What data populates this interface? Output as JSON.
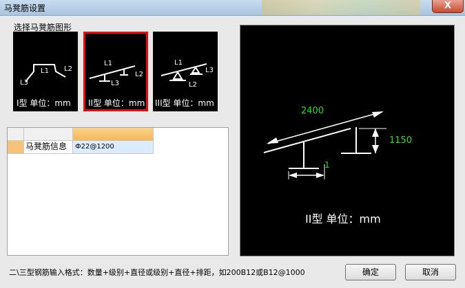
{
  "window": {
    "title": "马凳筋设置",
    "close_label": "X"
  },
  "shape_group": {
    "label": "选择马凳筋图形",
    "options": [
      {
        "caption": "I型 单位：mm",
        "labels": [
          "L1",
          "L2",
          "L3"
        ],
        "selected": false
      },
      {
        "caption": "II型 单位：mm",
        "labels": [
          "L1",
          "L2",
          "L3"
        ],
        "selected": true
      },
      {
        "caption": "III型 单位：mm",
        "labels": [
          "L1",
          "L3",
          "L2"
        ],
        "selected": false
      }
    ]
  },
  "grid": {
    "row_label": "马凳筋信息",
    "row_value": "Ф22@1200"
  },
  "preview": {
    "dim_length": "2400",
    "dim_height": "1150",
    "dim_foot": "1",
    "caption": "II型 单位：mm"
  },
  "hint": "二\\三型钢筋输入格式：数量+级别+直径或级别+直径+排距，如200B12或B12@1000",
  "buttons": {
    "ok": "确定",
    "cancel": "取消"
  },
  "colors": {
    "selected_border": "#e01010",
    "dimension_text": "#22dd22"
  }
}
